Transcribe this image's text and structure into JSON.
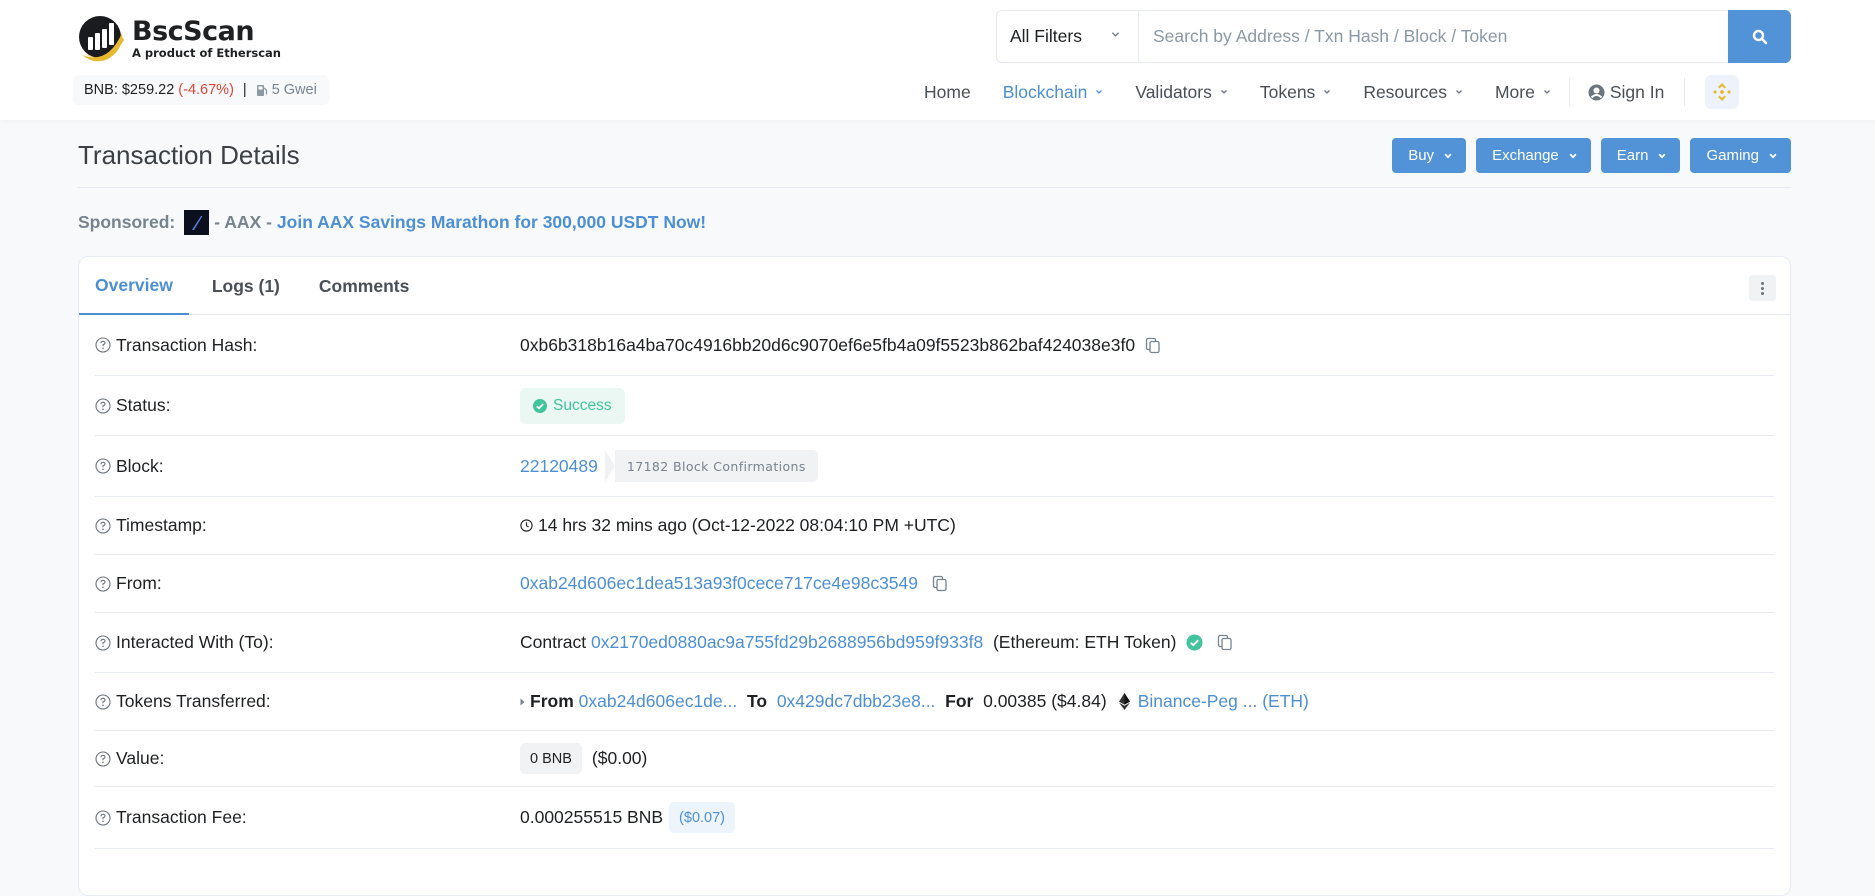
{
  "brand": {
    "name": "BscScan",
    "tagline": "A product of Etherscan"
  },
  "ticker": {
    "label": "BNB: $259.22",
    "change": "(-4.67%)",
    "separator": "|",
    "gas": "5 Gwei",
    "change_color": "#de4437"
  },
  "search": {
    "filter_label": "All Filters",
    "placeholder": "Search by Address / Txn Hash / Block / Token",
    "value": ""
  },
  "nav": {
    "items": [
      {
        "label": "Home",
        "has_caret": false,
        "active": false
      },
      {
        "label": "Blockchain",
        "has_caret": true,
        "active": true
      },
      {
        "label": "Validators",
        "has_caret": true,
        "active": false
      },
      {
        "label": "Tokens",
        "has_caret": true,
        "active": false
      },
      {
        "label": "Resources",
        "has_caret": true,
        "active": false
      },
      {
        "label": "More",
        "has_caret": true,
        "active": false
      }
    ],
    "sign_in": "Sign In",
    "network_icon": "bnb-chain-icon"
  },
  "page": {
    "title": "Transaction Details",
    "cta_buttons": [
      "Buy",
      "Exchange",
      "Earn",
      "Gaming"
    ]
  },
  "sponsored": {
    "label": "Sponsored:",
    "name": "- AAX -",
    "link_text": "Join AAX Savings Marathon for 300,000 USDT Now!"
  },
  "tabs": [
    {
      "label": "Overview",
      "active": true
    },
    {
      "label": "Logs (1)",
      "active": false
    },
    {
      "label": "Comments",
      "active": false
    }
  ],
  "details": {
    "hash": {
      "label": "Transaction Hash:",
      "value": "0xb6b318b16a4ba70c4916bb20d6c9070ef6e5fb4a09f5523b862baf424038e3f0"
    },
    "status": {
      "label": "Status:",
      "value": "Success"
    },
    "block": {
      "label": "Block:",
      "value": "22120489",
      "confirmations": "17182 Block Confirmations"
    },
    "timestamp": {
      "label": "Timestamp:",
      "value": "14 hrs 32 mins ago (Oct-12-2022 08:04:10 PM +UTC)"
    },
    "from": {
      "label": "From:",
      "value": "0xab24d606ec1dea513a93f0cece717ce4e98c3549"
    },
    "to": {
      "label": "Interacted With (To):",
      "prefix": "Contract",
      "address": "0x2170ed0880ac9a755fd29b2688956bd959f933f8",
      "name": "(Ethereum: ETH Token)"
    },
    "tokens": {
      "label": "Tokens Transferred:",
      "from_label": "From",
      "from": "0xab24d606ec1de...",
      "to_label": "To",
      "to": "0x429dc7dbb23e8...",
      "for_label": "For",
      "amount": "0.00385 ($4.84)",
      "token": "Binance-Peg ... (ETH)"
    },
    "value": {
      "label": "Value:",
      "amount": "0 BNB",
      "usd": "($0.00)"
    },
    "fee": {
      "label": "Transaction Fee:",
      "amount": "0.000255515 BNB",
      "usd": "($0.07)"
    }
  },
  "colors": {
    "accent": "#5193d6",
    "link": "#4d8fd5",
    "success": "#41c39c",
    "brand_gold": "#e7b931"
  }
}
